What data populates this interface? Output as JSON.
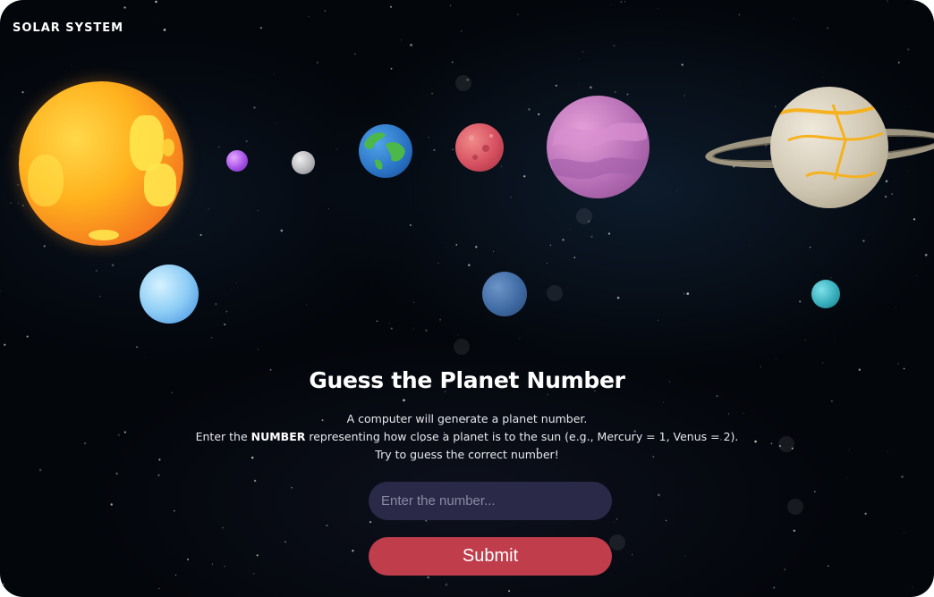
{
  "app": {
    "logo": "SOLAR SYSTEM"
  },
  "planets": [
    {
      "name": "sun",
      "color": "#ffb21e"
    },
    {
      "name": "mercury",
      "color": "#a652e6"
    },
    {
      "name": "venus",
      "color": "#b7b7bc"
    },
    {
      "name": "earth",
      "color": "#2a72c4"
    },
    {
      "name": "mars",
      "color": "#d65060"
    },
    {
      "name": "jupiter",
      "color": "#b76fb6"
    },
    {
      "name": "saturn",
      "color": "#cfc6b1"
    },
    {
      "name": "uranus",
      "color": "#8ecdf5"
    },
    {
      "name": "neptune",
      "color": "#3f6aa3"
    },
    {
      "name": "pluto",
      "color": "#37aebc"
    }
  ],
  "game": {
    "title": "Guess the Planet Number",
    "line1": "A computer will generate a planet number.",
    "line2_prefix": "Enter the ",
    "line2_bold": "NUMBER",
    "line2_suffix": " representing how close a planet is to the sun (e.g., Mercury = 1, Venus = 2).",
    "line3": "Try to guess the correct number!",
    "input_placeholder": "Enter the number...",
    "input_value": "",
    "submit_label": "Submit"
  },
  "colors": {
    "background": "#03060b",
    "input_bg": "#2a2948",
    "submit_bg": "#c03d4c"
  }
}
